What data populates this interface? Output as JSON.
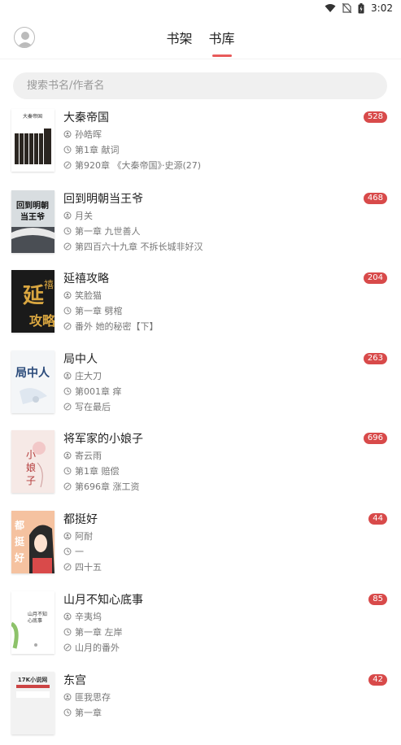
{
  "status_bar": {
    "time": "3:02"
  },
  "header": {
    "tabs": [
      {
        "label": "书架",
        "active": false
      },
      {
        "label": "书库",
        "active": true
      }
    ],
    "accent_color": "#e85a5a"
  },
  "search": {
    "placeholder": "搜索书名/作者名"
  },
  "books": [
    {
      "title": "大秦帝国",
      "author": "孙皓晖",
      "first_chapter": "第1章 献词",
      "latest_chapter": "第920章 《大秦帝国》·史源(27)",
      "count": "528",
      "cover_text": "大秦帝国",
      "cover_bg": "#ffffff"
    },
    {
      "title": "回到明朝当王爷",
      "author": "月关",
      "first_chapter": "第一章 九世善人",
      "latest_chapter": "第四百六十九章 不拆长城非好汉",
      "count": "468",
      "cover_text": "回到明朝当王爷",
      "cover_bg": "#d8dde0"
    },
    {
      "title": "延禧攻略",
      "author": "笑脸猫",
      "first_chapter": "第一章 劈棺",
      "latest_chapter": "番外 她的秘密【下】",
      "count": "204",
      "cover_text": "延禧攻略",
      "cover_bg": "#1a1a1a"
    },
    {
      "title": "局中人",
      "author": "庄大刀",
      "first_chapter": "第001章 痒",
      "latest_chapter": "写在最后",
      "count": "263",
      "cover_text": "局中人",
      "cover_bg": "#f4f6f8"
    },
    {
      "title": "将军家的小娘子",
      "author": "寄云雨",
      "first_chapter": "第1章 赔偿",
      "latest_chapter": "第696章 涨工资",
      "count": "696",
      "cover_text": "小娘子",
      "cover_bg": "#f6e9e6"
    },
    {
      "title": "都挺好",
      "author": "阿耐",
      "first_chapter": "一",
      "latest_chapter": "四十五",
      "count": "44",
      "cover_text": "都挺好",
      "cover_bg": "#f5c2a0"
    },
    {
      "title": "山月不知心底事",
      "author": "辛夷坞",
      "first_chapter": "第一章 左岸",
      "latest_chapter": "山月的番外",
      "count": "85",
      "cover_text": "山月不知心底事",
      "cover_bg": "#ffffff"
    },
    {
      "title": "东宫",
      "author": "匪我思存",
      "first_chapter": "第一章",
      "latest_chapter": "",
      "count": "42",
      "cover_text": "17K小说网",
      "cover_bg": "#f2f2f2"
    }
  ]
}
